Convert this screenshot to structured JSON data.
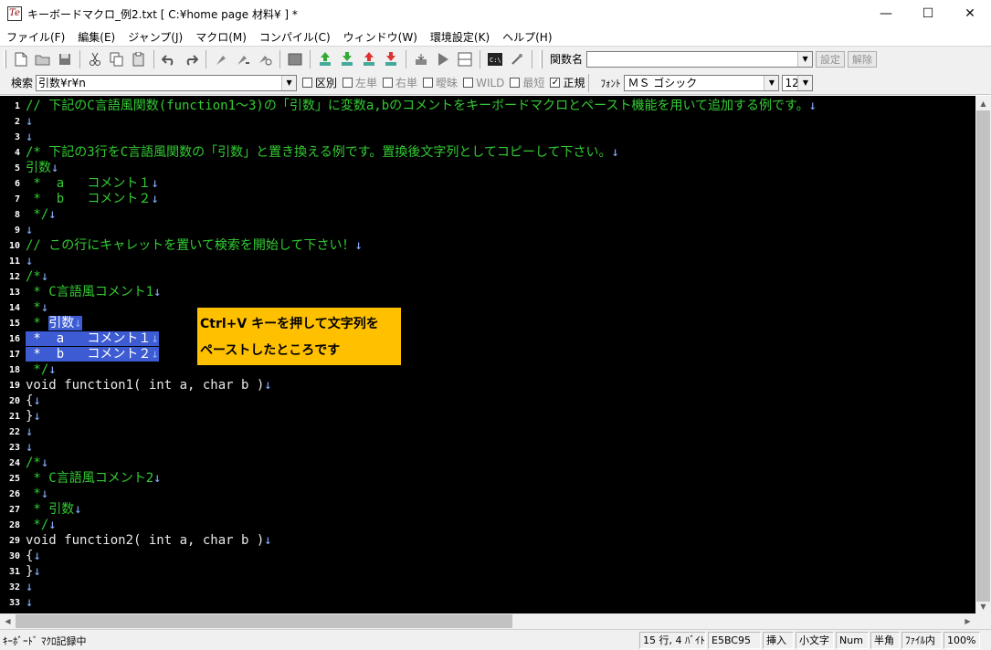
{
  "window": {
    "title": "キーボードマクロ_例2.txt [ C:¥home page 材料¥ ] *",
    "app_icon": "Te",
    "minimize": "—",
    "maximize": "☐",
    "close": "✕"
  },
  "menu": [
    "ファイル(F)",
    "編集(E)",
    "ジャンプ(J)",
    "マクロ(M)",
    "コンパイル(C)",
    "ウィンドウ(W)",
    "環境設定(K)",
    "ヘルプ(H)"
  ],
  "toolbar": {
    "icons": [
      "new-file-icon",
      "open-folder-icon",
      "save-icon",
      "cut-icon",
      "copy-icon",
      "paste-icon",
      "undo-icon",
      "redo-icon",
      "marker-icon",
      "marker-jump-icon",
      "find-marker-icon",
      "window-icon",
      "jump-up-icon",
      "jump-down-icon",
      "jump-up-red-icon",
      "jump-down-red-icon",
      "record-macro-icon",
      "play-macro-icon",
      "split-icon",
      "command-prompt-icon",
      "link-icon"
    ],
    "func_label": "関数名",
    "func_value": "",
    "set_button": "設定",
    "clear_button": "解除"
  },
  "search": {
    "label": "検索",
    "value": "引数¥r¥n",
    "options": [
      {
        "label": "区別",
        "checked": false,
        "enabled": true
      },
      {
        "label": "左単",
        "checked": false,
        "enabled": false
      },
      {
        "label": "右単",
        "checked": false,
        "enabled": false
      },
      {
        "label": "曖昧",
        "checked": false,
        "enabled": false
      },
      {
        "label": "WILD",
        "checked": false,
        "enabled": false
      },
      {
        "label": "最短",
        "checked": false,
        "enabled": false
      },
      {
        "label": "正規",
        "checked": true,
        "enabled": true
      }
    ],
    "font_label": "ﾌｫﾝﾄ",
    "font_value": "ＭＳ ゴシック",
    "size_value": "12"
  },
  "editor": {
    "colors": {
      "comment": "#33cc33",
      "code": "#e8e8e8",
      "keyword": "#d0d0ff",
      "highlight": "#3d5bd2"
    },
    "lines": [
      {
        "n": "1",
        "text": "// 下記のC言語風関数(function1～3)の「引数」に変数a,bのコメントをキーボードマクロとペースト機能を用いて追加する例です。",
        "kind": "comment"
      },
      {
        "n": "2",
        "text": "",
        "kind": "comment"
      },
      {
        "n": "3",
        "text": "",
        "kind": "comment"
      },
      {
        "n": "4",
        "text": "/* 下記の3行をC言語風関数の「引数」と置き換える例です。置換後文字列としてコピーして下さい。",
        "kind": "comment"
      },
      {
        "n": "5",
        "text": "引数",
        "kind": "comment"
      },
      {
        "n": "6",
        "text": " *  a   コメント１",
        "kind": "comment"
      },
      {
        "n": "7",
        "text": " *  b   コメント２",
        "kind": "comment"
      },
      {
        "n": "8",
        "text": " */",
        "kind": "comment"
      },
      {
        "n": "9",
        "text": "",
        "kind": "comment"
      },
      {
        "n": "10",
        "text": "// この行にキャレットを置いて検索を開始して下さい！",
        "kind": "comment"
      },
      {
        "n": "11",
        "text": "",
        "kind": "comment"
      },
      {
        "n": "12",
        "text": "/*",
        "kind": "comment"
      },
      {
        "n": "13",
        "text": " * C言語風コメント1",
        "kind": "comment"
      },
      {
        "n": "14",
        "text": " *",
        "kind": "comment"
      },
      {
        "n": "15",
        "text": " * 引数",
        "kind": "comment",
        "hl_from": 3
      },
      {
        "n": "16",
        "text": " *  a   コメント１",
        "kind": "comment",
        "hl_from": 0
      },
      {
        "n": "17",
        "text": " *  b   コメント２",
        "kind": "comment",
        "hl_from": 0
      },
      {
        "n": "18",
        "text": " */",
        "kind": "comment"
      },
      {
        "n": "19",
        "text": "void function1( int a, char b )",
        "kind": "code"
      },
      {
        "n": "20",
        "text": "{",
        "kind": "code"
      },
      {
        "n": "21",
        "text": "}",
        "kind": "code"
      },
      {
        "n": "22",
        "text": "",
        "kind": "code"
      },
      {
        "n": "23",
        "text": "",
        "kind": "code"
      },
      {
        "n": "24",
        "text": "/*",
        "kind": "comment"
      },
      {
        "n": "25",
        "text": " * C言語風コメント2",
        "kind": "comment"
      },
      {
        "n": "26",
        "text": " *",
        "kind": "comment"
      },
      {
        "n": "27",
        "text": " * 引数",
        "kind": "comment"
      },
      {
        "n": "28",
        "text": " */",
        "kind": "comment"
      },
      {
        "n": "29",
        "text": "void function2( int a, char b )",
        "kind": "code"
      },
      {
        "n": "30",
        "text": "{",
        "kind": "code"
      },
      {
        "n": "31",
        "text": "}",
        "kind": "code"
      },
      {
        "n": "32",
        "text": "",
        "kind": "code"
      },
      {
        "n": "33",
        "text": "",
        "kind": "code"
      }
    ],
    "eol_mark": "↓",
    "callout": [
      "Ctrl+V キーを押して文字列を",
      "ペーストしたところです"
    ]
  },
  "status": {
    "left": "ｷｰﾎﾞｰﾄﾞ ﾏｸﾛ記録中",
    "position": "15 行, 4 ﾊﾞｲﾄ",
    "code": "E5BC95",
    "insert": "挿入",
    "case": "小文字",
    "num": "Num",
    "width": "半角",
    "file": "ﾌｧｲﾙ内",
    "zoom": "100%"
  }
}
